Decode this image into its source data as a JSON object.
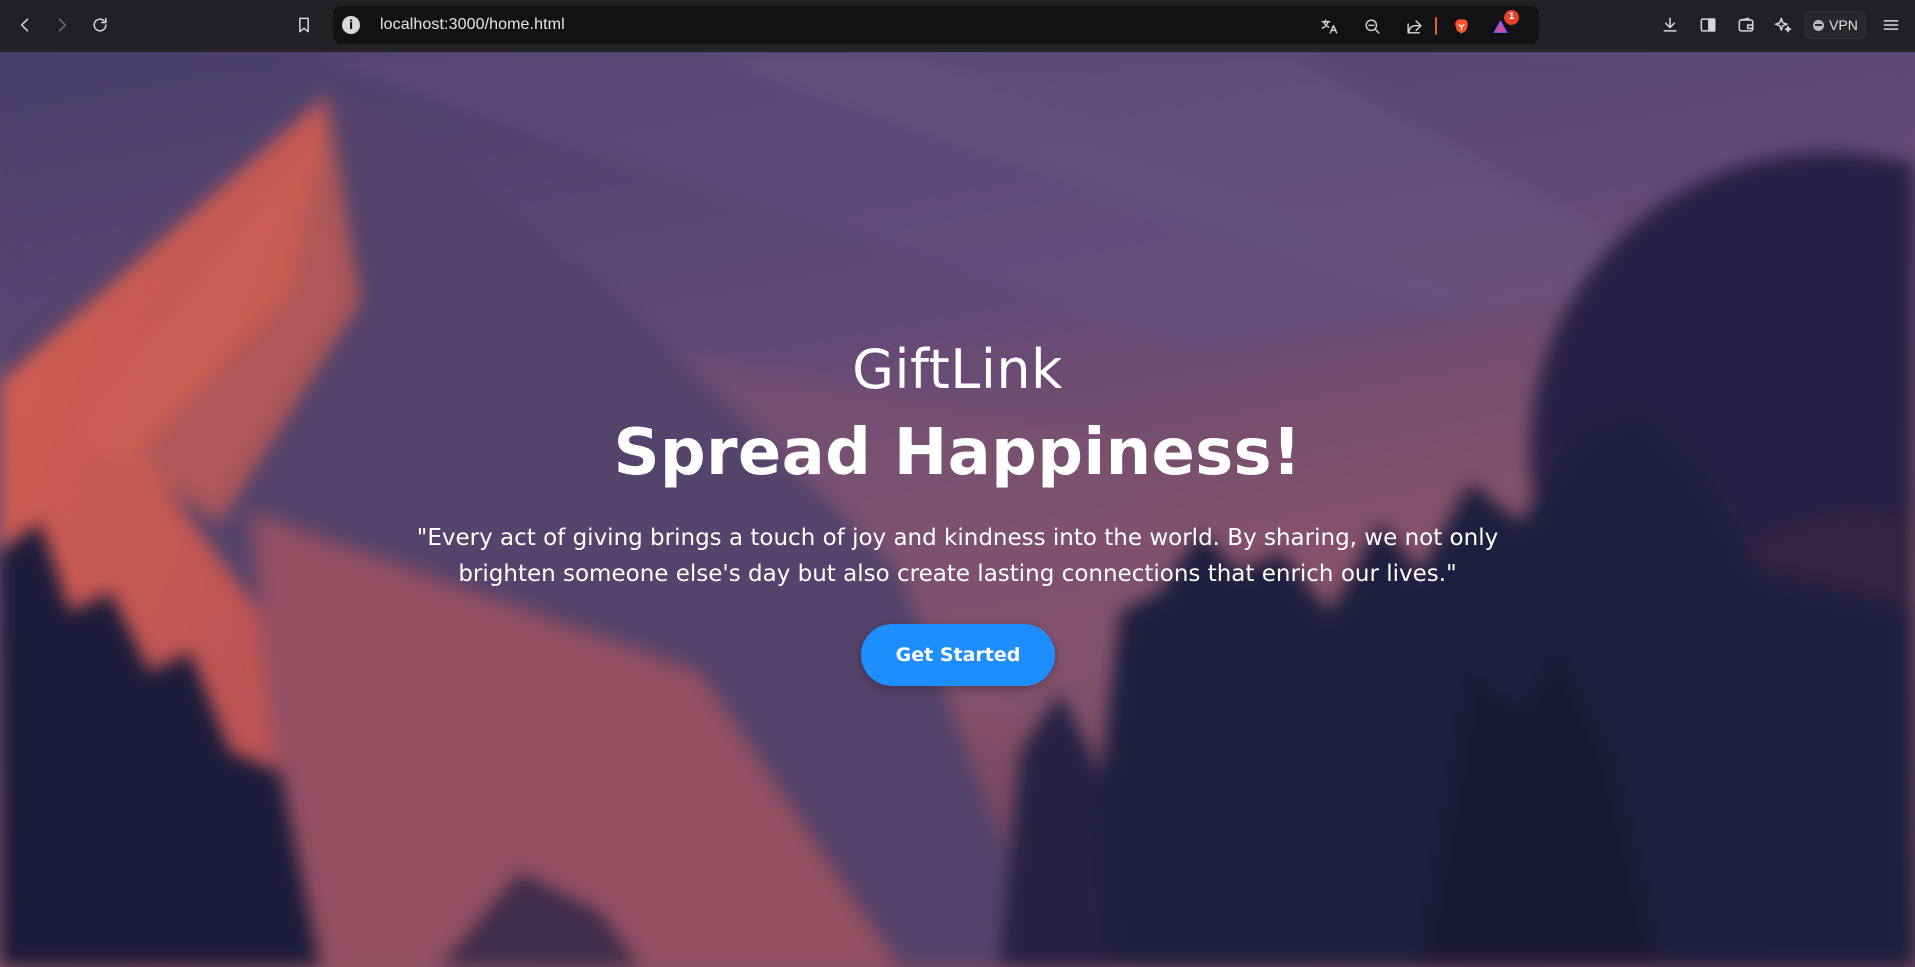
{
  "browser": {
    "url": "localhost:3000/home.html",
    "notification_count": "1",
    "vpn_label": "VPN",
    "icons": {
      "back": "back-arrow-icon",
      "forward": "forward-arrow-icon",
      "reload": "reload-icon",
      "bookmark": "bookmark-icon",
      "site_info": "info-icon",
      "translate": "translate-icon",
      "zoom": "zoom-out-icon",
      "share": "share-icon",
      "brave_shields": "brave-lion-icon",
      "rewards": "brave-rewards-icon",
      "downloads": "download-icon",
      "sidebar": "sidebar-icon",
      "wallet": "wallet-icon",
      "leo": "leo-ai-icon",
      "menu": "hamburger-menu-icon"
    },
    "accent_color": "#e2621e"
  },
  "hero": {
    "brand": "GiftLink",
    "headline": "Spread Happiness!",
    "quote": "\"Every act of giving brings a touch of joy and kindness into the world. By sharing, we not only brighten someone else's day but also create lasting connections that enrich our lives.\"",
    "cta_label": "Get Started",
    "cta_color": "#1e8eff",
    "text_color": "#ffffff"
  }
}
